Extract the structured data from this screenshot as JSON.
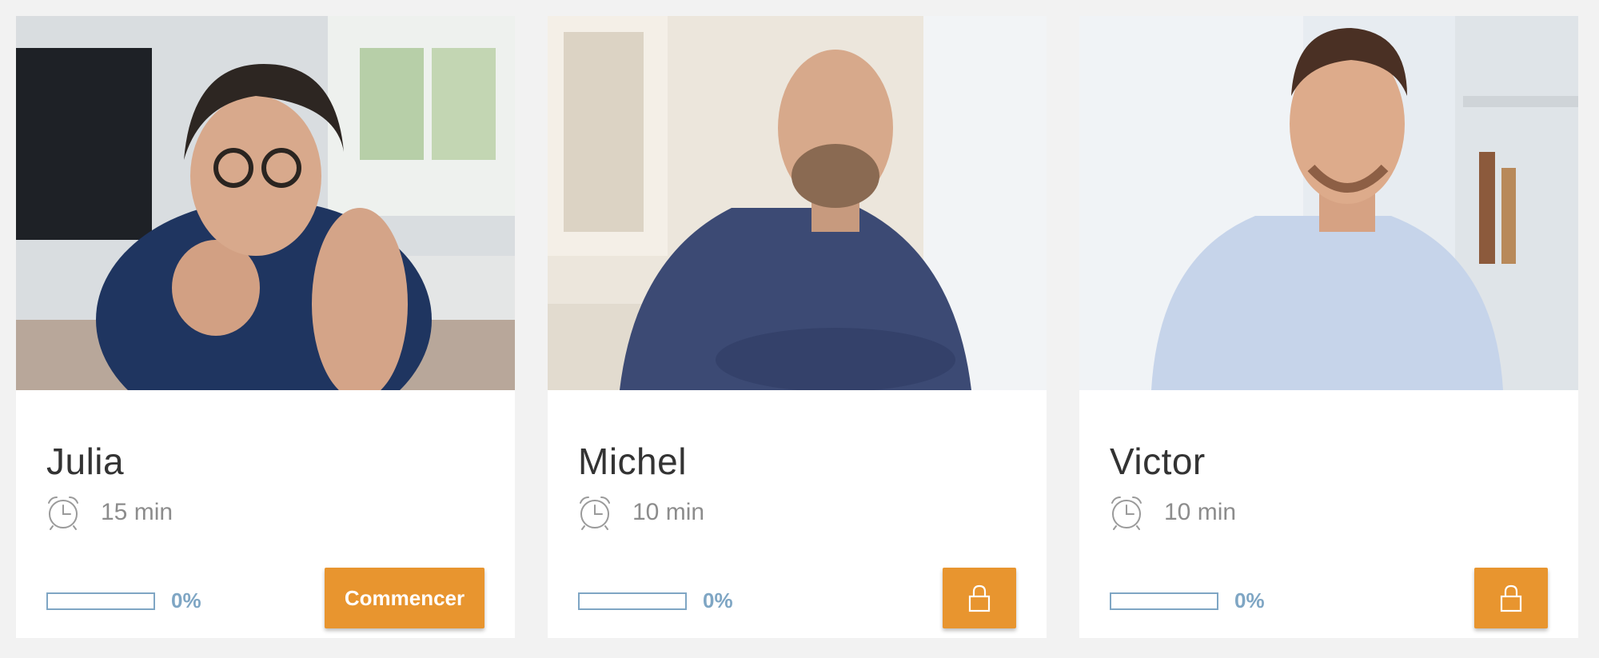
{
  "colors": {
    "accent": "#e8952f",
    "progress": "#7fa6c4",
    "background": "#f2f2f2"
  },
  "cards": [
    {
      "name": "Julia",
      "duration": "15 min",
      "progress": 0,
      "progress_label": "0%",
      "action": {
        "type": "start",
        "label": "Commencer"
      },
      "icon": "alarm-clock-icon"
    },
    {
      "name": "Michel",
      "duration": "10 min",
      "progress": 0,
      "progress_label": "0%",
      "action": {
        "type": "locked",
        "icon": "lock-icon"
      },
      "icon": "alarm-clock-icon"
    },
    {
      "name": "Victor",
      "duration": "10 min",
      "progress": 0,
      "progress_label": "0%",
      "action": {
        "type": "locked",
        "icon": "lock-icon"
      },
      "icon": "alarm-clock-icon"
    }
  ]
}
